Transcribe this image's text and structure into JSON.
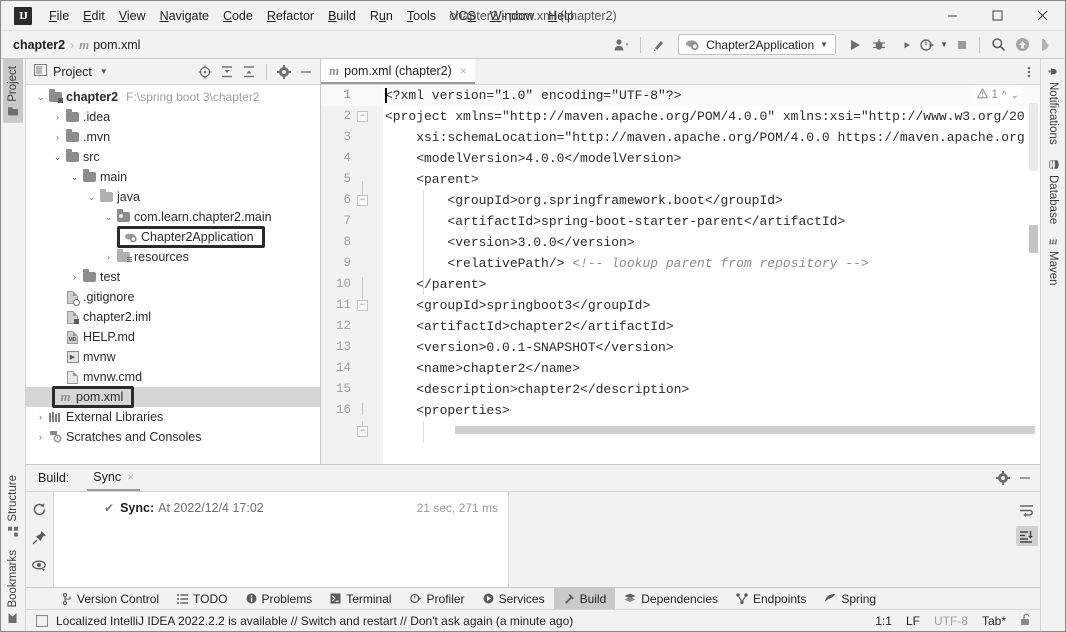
{
  "window": {
    "title": "chapter2 - pom.xml (chapter2)",
    "logo": "IJ",
    "controls": {
      "minimize": "minimize-icon",
      "maximize": "maximize-icon",
      "close": "close-icon"
    }
  },
  "menu": {
    "items": [
      {
        "label": "File",
        "mnemonic": "F"
      },
      {
        "label": "Edit",
        "mnemonic": "E"
      },
      {
        "label": "View",
        "mnemonic": "V"
      },
      {
        "label": "Navigate",
        "mnemonic": "N"
      },
      {
        "label": "Code",
        "mnemonic": "C"
      },
      {
        "label": "Refactor",
        "mnemonic": "R"
      },
      {
        "label": "Build",
        "mnemonic": "B"
      },
      {
        "label": "Run",
        "mnemonic": "u"
      },
      {
        "label": "Tools",
        "mnemonic": "T"
      },
      {
        "label": "VCS",
        "mnemonic": "S"
      },
      {
        "label": "Window",
        "mnemonic": "W"
      },
      {
        "label": "Help",
        "mnemonic": "H"
      }
    ]
  },
  "navbar": {
    "project": "chapter2",
    "separator": "›",
    "file_icon": "m",
    "file": "pom.xml",
    "run_config": "Chapter2Application",
    "icons": [
      "settings-sync-icon",
      "updates-icon",
      "run-icon",
      "debug-icon",
      "run-coverage-icon",
      "profiler-icon",
      "stop-icon",
      "search-everywhere-icon",
      "updates-available-icon",
      "ai-assistant-icon"
    ]
  },
  "project_panel": {
    "title": "Project",
    "header_icons": [
      "select-opened-file-icon",
      "expand-all-icon",
      "collapse-all-icon",
      "gear-icon",
      "hide-icon"
    ],
    "tree": [
      {
        "depth": 0,
        "arrow": "down",
        "icon": "module-folder-icon",
        "label": "chapter2",
        "bold": true,
        "path": "F:\\spring boot 3\\chapter2"
      },
      {
        "depth": 1,
        "arrow": "right",
        "icon": "folder-icon",
        "label": ".idea"
      },
      {
        "depth": 1,
        "arrow": "right",
        "icon": "folder-icon",
        "label": ".mvn"
      },
      {
        "depth": 1,
        "arrow": "down",
        "icon": "folder-icon",
        "label": "src"
      },
      {
        "depth": 2,
        "arrow": "down",
        "icon": "folder-icon",
        "label": "main"
      },
      {
        "depth": 3,
        "arrow": "down",
        "icon": "source-folder-icon",
        "label": "java"
      },
      {
        "depth": 4,
        "arrow": "down",
        "icon": "package-icon",
        "label": "com.learn.chapter2.main"
      },
      {
        "depth": 5,
        "arrow": "none",
        "icon": "spring-class-icon",
        "label": "Chapter2Application",
        "highlighted": true
      },
      {
        "depth": 4,
        "arrow": "right",
        "icon": "resource-folder-icon",
        "label": "resources"
      },
      {
        "depth": 2,
        "arrow": "right",
        "icon": "test-folder-icon",
        "label": "test"
      },
      {
        "depth": 1,
        "arrow": "none",
        "icon": "gitignore-file-icon",
        "label": ".gitignore"
      },
      {
        "depth": 1,
        "arrow": "none",
        "icon": "iml-file-icon",
        "label": "chapter2.iml"
      },
      {
        "depth": 1,
        "arrow": "none",
        "icon": "markdown-file-icon",
        "label": "HELP.md"
      },
      {
        "depth": 1,
        "arrow": "none",
        "icon": "script-file-icon",
        "label": "mvnw"
      },
      {
        "depth": 1,
        "arrow": "none",
        "icon": "cmd-file-icon",
        "label": "mvnw.cmd"
      },
      {
        "depth": 1,
        "arrow": "none",
        "icon": "maven-pom-icon",
        "label": "pom.xml",
        "highlighted": true,
        "selected": true
      },
      {
        "depth": 0,
        "arrow": "right",
        "icon": "external-libraries-icon",
        "label": "External Libraries"
      },
      {
        "depth": 0,
        "arrow": "right",
        "icon": "scratches-icon",
        "label": "Scratches and Consoles"
      }
    ]
  },
  "editor": {
    "tab": {
      "icon": "m",
      "label": "pom.xml (chapter2)",
      "close": "×"
    },
    "inspection": {
      "icon": "warning-icon",
      "count": "1",
      "up": "⌃",
      "down": "⌄"
    },
    "lines": [
      {
        "n": "1",
        "text": "<?xml version=\"1.0\" encoding=\"UTF-8\"?>",
        "fold": "none",
        "current": true
      },
      {
        "n": "2",
        "text": "<project xmlns=\"http://maven.apache.org/POM/4.0.0\" xmlns:xsi=\"http://www.w3.org/20",
        "fold": "start"
      },
      {
        "n": "3",
        "text": "    xsi:schemaLocation=\"http://maven.apache.org/POM/4.0.0 https://maven.apache.org",
        "fold": "none"
      },
      {
        "n": "4",
        "text": "    <modelVersion>4.0.0</modelVersion>",
        "fold": "none"
      },
      {
        "n": "5",
        "text": "    <parent>",
        "fold": "start"
      },
      {
        "n": "6",
        "text": "        <groupId>org.springframework.boot</groupId>",
        "fold": "none"
      },
      {
        "n": "7",
        "text": "        <artifactId>spring-boot-starter-parent</artifactId>",
        "fold": "none"
      },
      {
        "n": "8",
        "text": "        <version>3.0.0</version>",
        "fold": "none"
      },
      {
        "n": "9",
        "text": "        <relativePath/>",
        "comment": " <!-- lookup parent from repository -->",
        "fold": "none"
      },
      {
        "n": "10",
        "text": "    </parent>",
        "fold": "end"
      },
      {
        "n": "11",
        "text": "    <groupId>springboot3</groupId>",
        "fold": "none"
      },
      {
        "n": "12",
        "text": "    <artifactId>chapter2</artifactId>",
        "fold": "none"
      },
      {
        "n": "13",
        "text": "    <version>0.0.1-SNAPSHOT</version>",
        "fold": "none"
      },
      {
        "n": "14",
        "text": "    <name>chapter2</name>",
        "fold": "none"
      },
      {
        "n": "15",
        "text": "    <description>chapter2</description>",
        "fold": "none"
      },
      {
        "n": "16",
        "text": "    <properties>",
        "fold": "start"
      }
    ]
  },
  "build_panel": {
    "label": "Build:",
    "tab": "Sync",
    "tab_close": "×",
    "header_icons": [
      "gear-icon",
      "hide-icon"
    ],
    "left_icons": [
      "rerun-icon",
      "pin-icon",
      "filter-icon"
    ],
    "right_icons": [
      "soft-wrap-icon",
      "scroll-to-end-icon"
    ],
    "result": {
      "status_icon": "check-icon",
      "title": "Sync:",
      "detail": "At 2022/12/4 17:02",
      "duration": "21 sec, 271 ms"
    }
  },
  "tool_windows_bottom": [
    {
      "label": "Version Control",
      "icon": "branch-icon"
    },
    {
      "label": "TODO",
      "icon": "todo-icon"
    },
    {
      "label": "Problems",
      "icon": "problems-icon"
    },
    {
      "label": "Terminal",
      "icon": "terminal-icon"
    },
    {
      "label": "Profiler",
      "icon": "profiler-icon"
    },
    {
      "label": "Services",
      "icon": "services-icon"
    },
    {
      "label": "Build",
      "icon": "build-icon",
      "selected": true
    },
    {
      "label": "Dependencies",
      "icon": "dependencies-icon"
    },
    {
      "label": "Endpoints",
      "icon": "endpoints-icon"
    },
    {
      "label": "Spring",
      "icon": "spring-leaf-icon"
    }
  ],
  "left_stripe": [
    {
      "label": "Project",
      "icon": "project-folder-icon",
      "selected": true
    },
    {
      "label": "Structure",
      "icon": "structure-icon"
    },
    {
      "label": "Bookmarks",
      "icon": "bookmark-icon"
    }
  ],
  "right_stripe": [
    {
      "label": "Notifications",
      "icon": "notifications-bell-icon"
    },
    {
      "label": "Database",
      "icon": "database-icon"
    },
    {
      "label": "Maven",
      "icon": "maven-m-icon"
    }
  ],
  "statusbar": {
    "icon": "ide-message-icon",
    "message": "Localized IntelliJ IDEA 2022.2.2 is available // Switch and restart // Don't ask again (a minute ago)",
    "caret": "1:1",
    "line_sep": "LF",
    "encoding": "UTF-8",
    "indent": "Tab*",
    "lock": "read-write-icon"
  },
  "colors": {
    "bg": "#f2f2f2",
    "panel": "#ffffff",
    "selection": "#d6d6d6",
    "border": "#c9c9c9",
    "accent": "#2b2b2b",
    "muted": "#a0a0a0"
  }
}
